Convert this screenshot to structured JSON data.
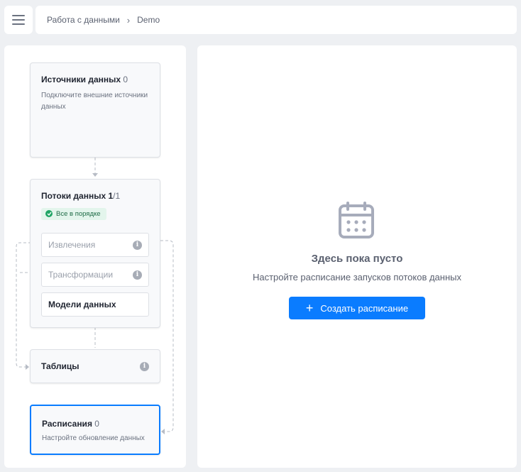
{
  "breadcrumb": {
    "root": "Работа с данными",
    "separator": "›",
    "current": "Demo"
  },
  "sources": {
    "title": "Источники данных",
    "count": "0",
    "subtitle": "Подключите внешние источники данных"
  },
  "flows": {
    "title": "Потоки данных",
    "count_done": "1",
    "count_total": "/1",
    "status": "Все в порядке",
    "items": [
      {
        "label": "Извлечения",
        "state": "disabled",
        "icon": "info-icon"
      },
      {
        "label": "Трансформации",
        "state": "disabled",
        "icon": "info-icon"
      },
      {
        "label": "Модели данных",
        "state": "active"
      }
    ]
  },
  "tables": {
    "title": "Таблицы",
    "icon": "info-icon"
  },
  "schedules": {
    "title": "Расписания",
    "count": "0",
    "subtitle": "Настройте обновление данных"
  },
  "empty_state": {
    "icon": "calendar-icon",
    "title": "Здесь пока пусто",
    "subtitle": "Настройте расписание запусков потоков данных",
    "button_label": "Создать расписание"
  },
  "colors": {
    "accent": "#0a7cff",
    "success": "#20a565",
    "success_bg": "#e3f5ec"
  }
}
